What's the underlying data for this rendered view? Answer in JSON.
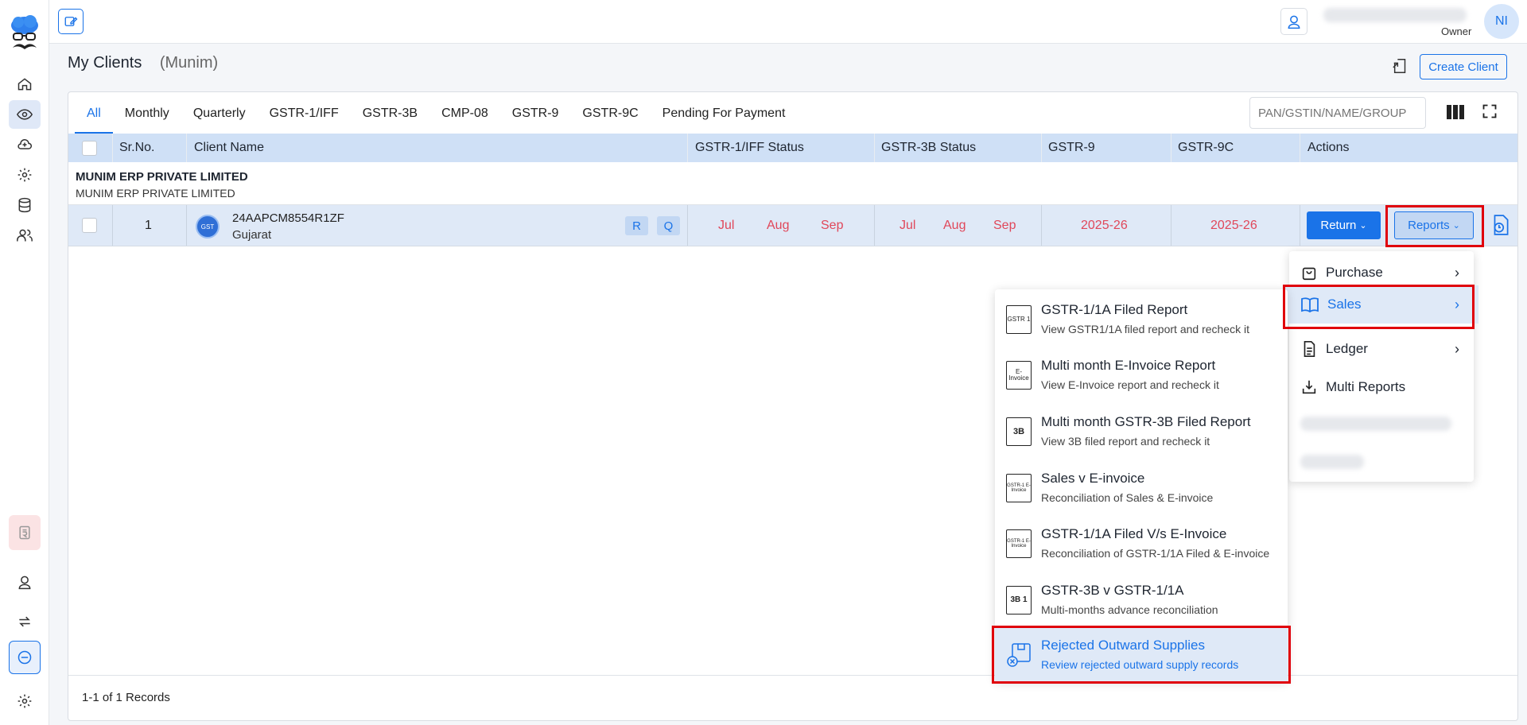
{
  "topbar": {
    "user_role": "Owner",
    "avatar_initials": "NI"
  },
  "page": {
    "title": "My Clients",
    "subtitle": "(Munim)",
    "create_client_label": "Create Client"
  },
  "tabs": [
    "All",
    "Monthly",
    "Quarterly",
    "GSTR-1/IFF",
    "GSTR-3B",
    "CMP-08",
    "GSTR-9",
    "GSTR-9C",
    "Pending For Payment"
  ],
  "search": {
    "placeholder": "PAN/GSTIN/NAME/GROUP"
  },
  "columns": {
    "srno": "Sr.No.",
    "client_name": "Client Name",
    "gstr1": "GSTR-1/IFF Status",
    "gstr3b": "GSTR-3B Status",
    "gstr9": "GSTR-9",
    "gstr9c": "GSTR-9C",
    "actions": "Actions"
  },
  "group": {
    "name": "MUNIM ERP PRIVATE LIMITED",
    "sub": "MUNIM ERP PRIVATE LIMITED"
  },
  "row": {
    "srno": "1",
    "gstin": "24AAPCM8554R1ZF",
    "state": "Gujarat",
    "badge_r": "R",
    "badge_q": "Q",
    "gstr1_months": [
      "Jul",
      "Aug",
      "Sep"
    ],
    "gstr3b_months": [
      "Jul",
      "Aug",
      "Sep"
    ],
    "gstr9": "2025-26",
    "gstr9c": "2025-26",
    "return_label": "Return",
    "reports_label": "Reports"
  },
  "reports_menu": {
    "purchase": "Purchase",
    "sales": "Sales",
    "ledger": "Ledger",
    "multi": "Multi Reports"
  },
  "sales_submenu": [
    {
      "title": "GSTR-1/1A Filed Report",
      "desc": "View GSTR1/1A filed report and recheck it",
      "icon_text": "GSTR 1"
    },
    {
      "title": "Multi month E-Invoice Report",
      "desc": "View E-Invoice report and recheck it",
      "icon_text": "E-Invoice"
    },
    {
      "title": "Multi month GSTR-3B Filed Report",
      "desc": "View 3B filed report and recheck it",
      "icon_text": "3B"
    },
    {
      "title": "Sales v E-invoice",
      "desc": "Reconciliation of Sales & E-invoice",
      "icon_text": "GSTR-1 E-Invoice"
    },
    {
      "title": "GSTR-1/1A Filed V/s E-Invoice",
      "desc": "Reconciliation of GSTR-1/1A Filed & E-invoice",
      "icon_text": "GSTR-1 E-Invoice"
    },
    {
      "title": "GSTR-3B v GSTR-1/1A",
      "desc": "Multi-months advance reconciliation",
      "icon_text": "3B 1"
    },
    {
      "title": "Rejected Outward Supplies",
      "desc": "Review rejected outward supply records",
      "icon_text": ""
    }
  ],
  "footer": {
    "records": "1-1 of 1 Records"
  },
  "colors": {
    "accent": "#1a73e8",
    "red": "#e0475a",
    "header_bg": "#cfe0f6"
  }
}
